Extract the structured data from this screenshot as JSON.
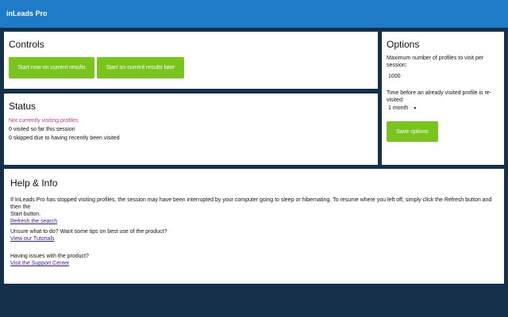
{
  "app": {
    "title": "inLeads Pro"
  },
  "controls": {
    "heading": "Controls",
    "start_now_label": "Start now on current results",
    "start_later_label": "Start on current results later"
  },
  "status": {
    "heading": "Status",
    "state": "Not currently visiting profiles",
    "visited": "0 visited so far this session",
    "skipped": "0 skipped due to having recently been visited"
  },
  "options": {
    "heading": "Options",
    "max_label": "Maximum number of profiles to visit per session:",
    "max_value": "1000",
    "revisit_label": "Time before an already visited profile is re-visited:",
    "revisit_value": "1 month",
    "save_label": "Save options"
  },
  "help": {
    "heading": "Help & Info",
    "para1_line1": "If InLeads Pro has stopped visiting profiles, the session may have been interrupted by your computer going to sleep or hibernating. To resume where you left off, simply click the Refresh button and then the",
    "para1_line2": "Start button.",
    "refresh_link": "Refresh the search",
    "para2": "Unsure what to do? Want some tips on best use of the product?",
    "tutorials_link": "View our Tutorials",
    "para3": "Having issues with the product?",
    "support_link": "Visit the Support Center"
  },
  "colors": {
    "topbar": "#1e7bc8",
    "button": "#7ac41e",
    "background": "#15304a",
    "status_text": "#c2407a"
  }
}
